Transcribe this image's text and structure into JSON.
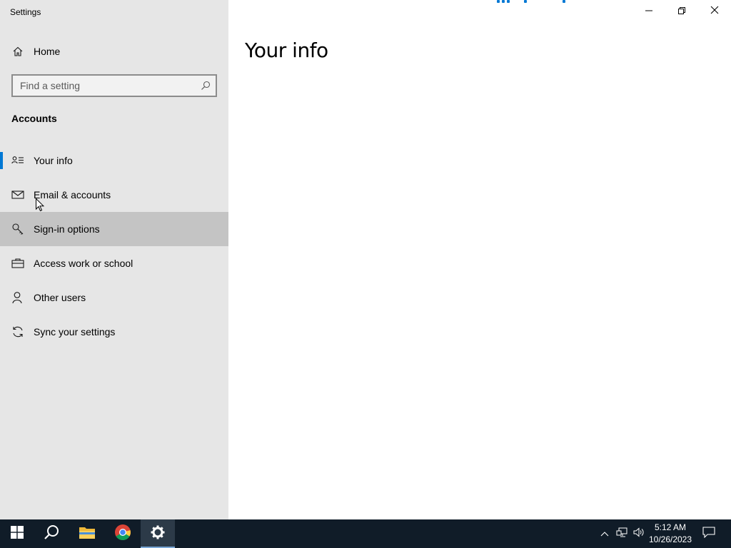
{
  "window": {
    "app_title": "Settings",
    "page_title": "Your info",
    "controls": {
      "minimize": "minimize",
      "maximize": "restore",
      "close": "close"
    }
  },
  "sidebar": {
    "home_label": "Home",
    "search": {
      "placeholder": "Find a setting",
      "value": ""
    },
    "section_title": "Accounts",
    "items": [
      {
        "label": "Your info",
        "icon": "person-card-icon",
        "selected": true,
        "hovered": false
      },
      {
        "label": "Email & accounts",
        "icon": "mail-icon",
        "selected": false,
        "hovered": false
      },
      {
        "label": "Sign-in options",
        "icon": "key-icon",
        "selected": false,
        "hovered": true
      },
      {
        "label": "Access work or school",
        "icon": "briefcase-icon",
        "selected": false,
        "hovered": false
      },
      {
        "label": "Other users",
        "icon": "person-icon",
        "selected": false,
        "hovered": false
      },
      {
        "label": "Sync your settings",
        "icon": "sync-icon",
        "selected": false,
        "hovered": false
      }
    ]
  },
  "taskbar": {
    "apps": [
      "windows-start-icon",
      "search-icon",
      "file-explorer-icon",
      "chrome-icon",
      "settings-gear-icon"
    ],
    "active_app": "settings-gear-icon",
    "clock": {
      "time": "5:12 AM",
      "date": "10/26/2023"
    },
    "tray": [
      "chevron-up-icon",
      "network-icon",
      "volume-icon",
      "notification-icon"
    ]
  },
  "colors": {
    "accent": "#0078d4",
    "sidebar_bg": "#e6e6e6",
    "hover_bg": "#c4c4c4",
    "taskbar_bg": "#101c28"
  }
}
